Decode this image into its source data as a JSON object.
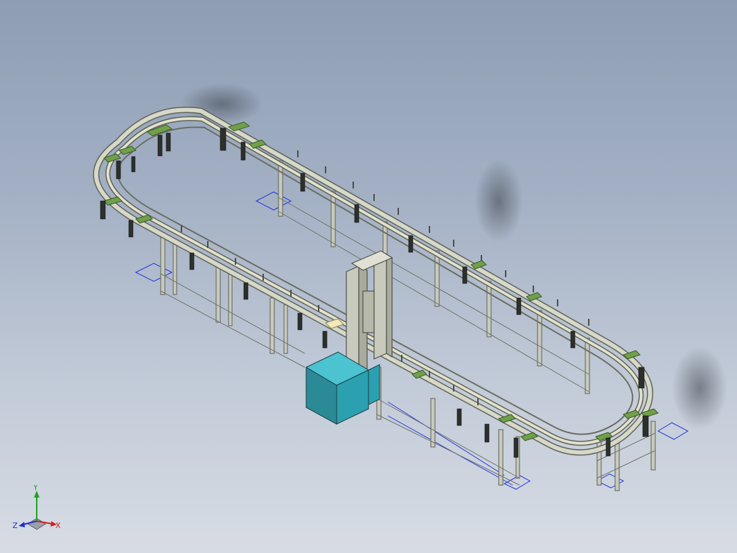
{
  "viewport": {
    "background_top": "#8e9db4",
    "background_bottom": "#d7dce4"
  },
  "model": {
    "description_icon": "conveyor-loop-model",
    "rail_color": "#c9ccb8",
    "frame_color": "#c7cabd",
    "bracket_color": "#6fa04a",
    "drive_unit_color": "#2aa0b0",
    "footprint_color": "#2233dd"
  },
  "triad": {
    "x_label": "X",
    "y_label": "Y",
    "z_label": "Z",
    "x_color": "#d02020",
    "y_color": "#20a020",
    "z_color": "#2030d0"
  }
}
